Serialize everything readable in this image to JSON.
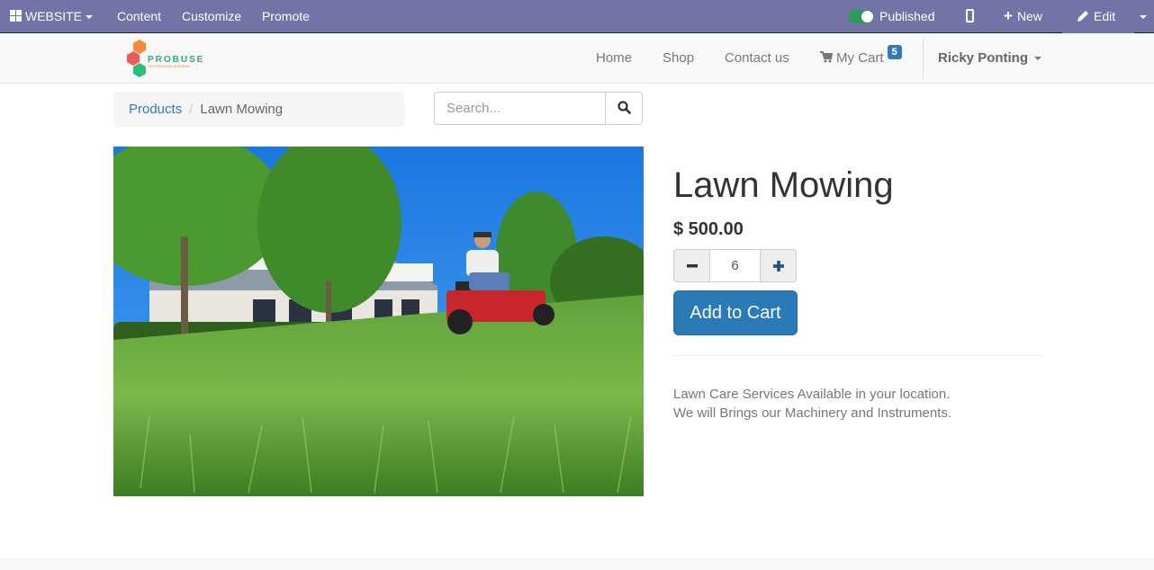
{
  "adminbar": {
    "website_label": "WEBSITE",
    "content_label": "Content",
    "customize_label": "Customize",
    "promote_label": "Promote",
    "published_label": "Published",
    "published_state": true,
    "new_label": "New",
    "edit_label": "Edit",
    "bar_color": "#7373a8",
    "toggle_color": "#2d9a5b"
  },
  "header": {
    "logo_text": "PROBUSE",
    "logo_tagline": "PROFESSIONAL BUSINESS",
    "nav": {
      "home": "Home",
      "shop": "Shop",
      "contact": "Contact us",
      "cart": "My Cart",
      "cart_count": "5"
    },
    "user_name": "Ricky Ponting"
  },
  "breadcrumb": {
    "parent": "Products",
    "separator": "/",
    "current": "Lawn Mowing"
  },
  "search": {
    "placeholder": "Search...",
    "value": ""
  },
  "product": {
    "image_alt": "Man riding a red lawn mower on a green lawn in front of a house",
    "title": "Lawn Mowing",
    "price": "$ 500.00",
    "quantity": "6",
    "add_to_cart_label": "Add to Cart",
    "description": [
      "Lawn Care Services Available in your location.",
      "We will Brings our Machinery and Instruments."
    ],
    "accent_color": "#2a7ab8"
  }
}
